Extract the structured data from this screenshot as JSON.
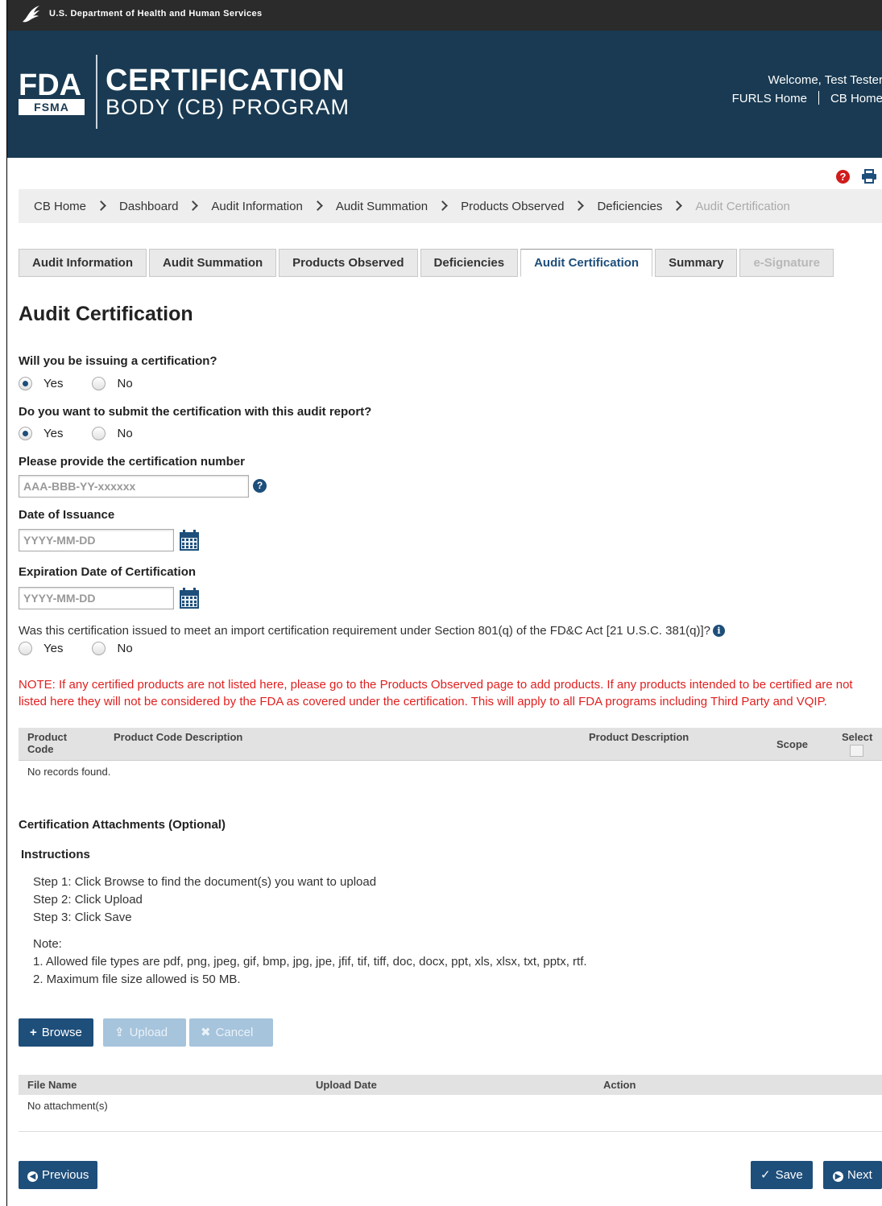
{
  "hhs": {
    "department": "U.S. Department of Health and Human Services"
  },
  "header": {
    "logo_fda": "FDA",
    "logo_fsma": "FSMA",
    "title": "CERTIFICATION",
    "subtitle": "BODY (CB) PROGRAM",
    "welcome": "Welcome, Test Tester",
    "links": [
      "FURLS Home",
      "CB Home"
    ]
  },
  "breadcrumb": [
    "CB Home",
    "Dashboard",
    "Audit Information",
    "Audit Summation",
    "Products Observed",
    "Deficiencies",
    "Audit Certification"
  ],
  "tabs": [
    {
      "label": "Audit Information",
      "state": "normal"
    },
    {
      "label": "Audit Summation",
      "state": "normal"
    },
    {
      "label": "Products Observed",
      "state": "normal"
    },
    {
      "label": "Deficiencies",
      "state": "normal"
    },
    {
      "label": "Audit Certification",
      "state": "active"
    },
    {
      "label": "Summary",
      "state": "normal"
    },
    {
      "label": "e-Signature",
      "state": "disabled"
    }
  ],
  "page_title": "Audit Certification",
  "form": {
    "issuing_question": "Will you be issuing a certification?",
    "issuing_options": [
      "Yes",
      "No"
    ],
    "issuing_selected": "Yes",
    "submit_question": "Do you want to submit the certification with this audit report?",
    "submit_options": [
      "Yes",
      "No"
    ],
    "submit_selected": "Yes",
    "cert_number_label": "Please provide the certification number",
    "cert_number_placeholder": "AAA-BBB-YY-xxxxxx",
    "cert_number_value": "",
    "issuance_label": "Date of Issuance",
    "issuance_placeholder": "YYYY-MM-DD",
    "expiration_label": "Expiration Date of Certification",
    "expiration_placeholder": "YYYY-MM-DD",
    "import_question": "Was this certification issued to meet an import certification requirement under Section 801(q) of the FD&C Act [21 U.S.C. 381(q)]?",
    "import_options": [
      "Yes",
      "No"
    ],
    "import_selected": ""
  },
  "note": "NOTE: If any certified products are not listed here, please go to the Products Observed page to add products. If any products intended to be certified are not listed here they will not be considered by the FDA as covered under the certification. This will apply to all FDA programs including Third Party and VQIP.",
  "products_table": {
    "col_product_code_1": "Product",
    "col_product_code_2": "Code",
    "col_code_desc": "Product Code Description",
    "col_prod_desc": "Product Description",
    "col_scope": "Scope",
    "col_select": "Select",
    "empty": "No records found."
  },
  "attachments": {
    "title": "Certification Attachments (Optional)",
    "instructions_title": "Instructions",
    "steps": [
      "Step 1: Click Browse to find the document(s) you want to upload",
      "Step 2: Click Upload",
      "Step 3: Click Save"
    ],
    "note_title": "Note:",
    "notes": [
      "1. Allowed file types are pdf, png, jpeg, gif, bmp, jpg, jpe, jfif, tif, tiff, doc, docx, ppt, xls, xlsx, txt, pptx, rtf.",
      "2. Maximum file size allowed is 50 MB."
    ],
    "browse": "Browse",
    "upload": "Upload",
    "cancel": "Cancel",
    "col_file_name": "File Name",
    "col_upload_date": "Upload Date",
    "col_action": "Action",
    "empty": "No attachment(s)"
  },
  "footer": {
    "previous": "Previous",
    "save": "Save",
    "next": "Next"
  },
  "colors": {
    "header_bg": "#193a52",
    "primary": "#1e4e7a",
    "note_red": "#e02020",
    "help_red": "#d01c1c"
  }
}
